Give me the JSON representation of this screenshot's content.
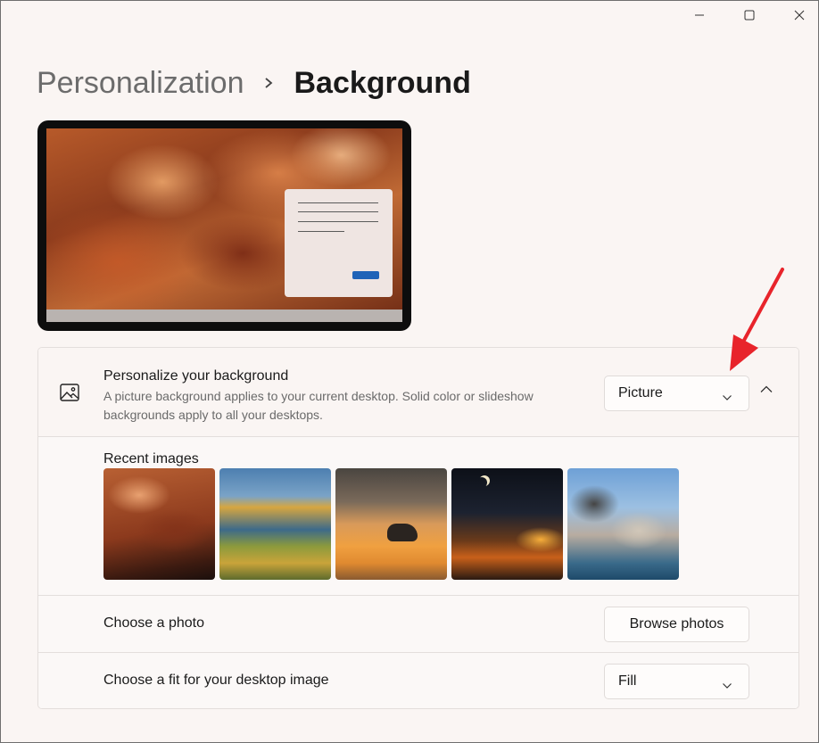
{
  "window": {
    "controls": [
      "minimize",
      "maximize",
      "close"
    ]
  },
  "breadcrumb": {
    "parent": "Personalization",
    "separator_icon": "chevron-right-icon",
    "current": "Background"
  },
  "preview": {
    "description_hidden": true
  },
  "background_setting": {
    "icon": "picture-icon",
    "title": "Personalize your background",
    "description": "A picture background applies to your current desktop. Solid color or slideshow backgrounds apply to all your desktops.",
    "selected": "Picture",
    "expanded": true
  },
  "recent_images": {
    "title": "Recent images",
    "count": 5
  },
  "choose_photo": {
    "label": "Choose a photo",
    "button": "Browse photos"
  },
  "fit": {
    "label": "Choose a fit for your desktop image",
    "selected": "Fill"
  },
  "colors": {
    "accent": "#1f63b8",
    "annotation_arrow": "#e8242b",
    "background": "#faf5f3"
  }
}
